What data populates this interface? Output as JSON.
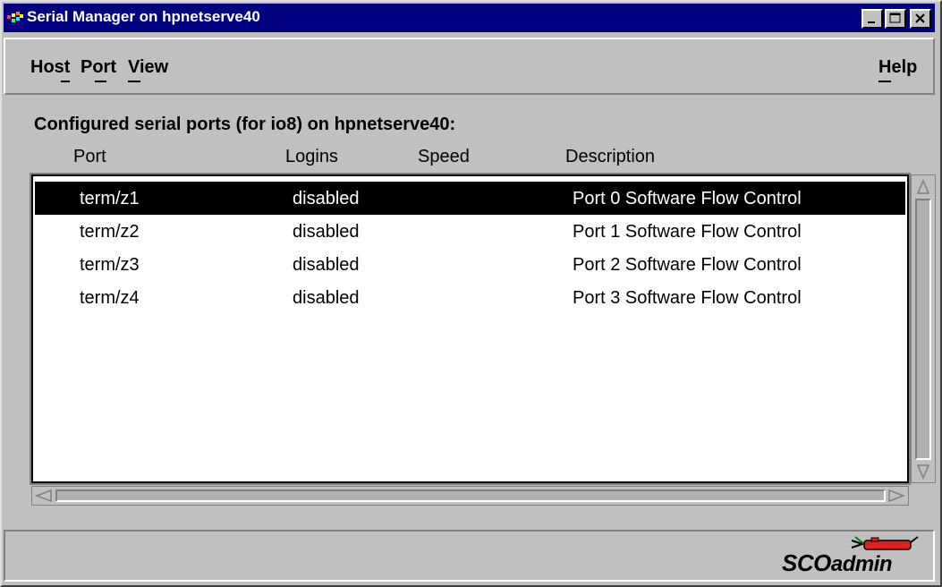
{
  "window": {
    "title": "Serial Manager on hpnetserve40",
    "controls": {
      "minimize": "minimize-icon",
      "maximize": "maximize-icon",
      "close": "close-icon"
    }
  },
  "menu": {
    "host": "Host",
    "port": "Port",
    "view": "View",
    "help": "Help"
  },
  "main": {
    "heading": "Configured serial ports (for io8) on hpnetserve40:",
    "columns": [
      "Port",
      "Logins",
      "Speed",
      "Description"
    ],
    "rows": [
      {
        "port": "term/z1",
        "logins": "disabled",
        "speed": "",
        "description": "Port 0 Software Flow Control",
        "selected": true
      },
      {
        "port": "term/z2",
        "logins": "disabled",
        "speed": "",
        "description": "Port 1 Software Flow Control",
        "selected": false
      },
      {
        "port": "term/z3",
        "logins": "disabled",
        "speed": "",
        "description": "Port 2 Software Flow Control",
        "selected": false
      },
      {
        "port": "term/z4",
        "logins": "disabled",
        "speed": "",
        "description": "Port 3 Software Flow Control",
        "selected": false
      }
    ]
  },
  "footer": {
    "logo_main": "SCO",
    "logo_sub": "admin"
  },
  "colors": {
    "titlebar": "#000080",
    "window_bg": "#c0c0c0",
    "selection": "#000000"
  }
}
